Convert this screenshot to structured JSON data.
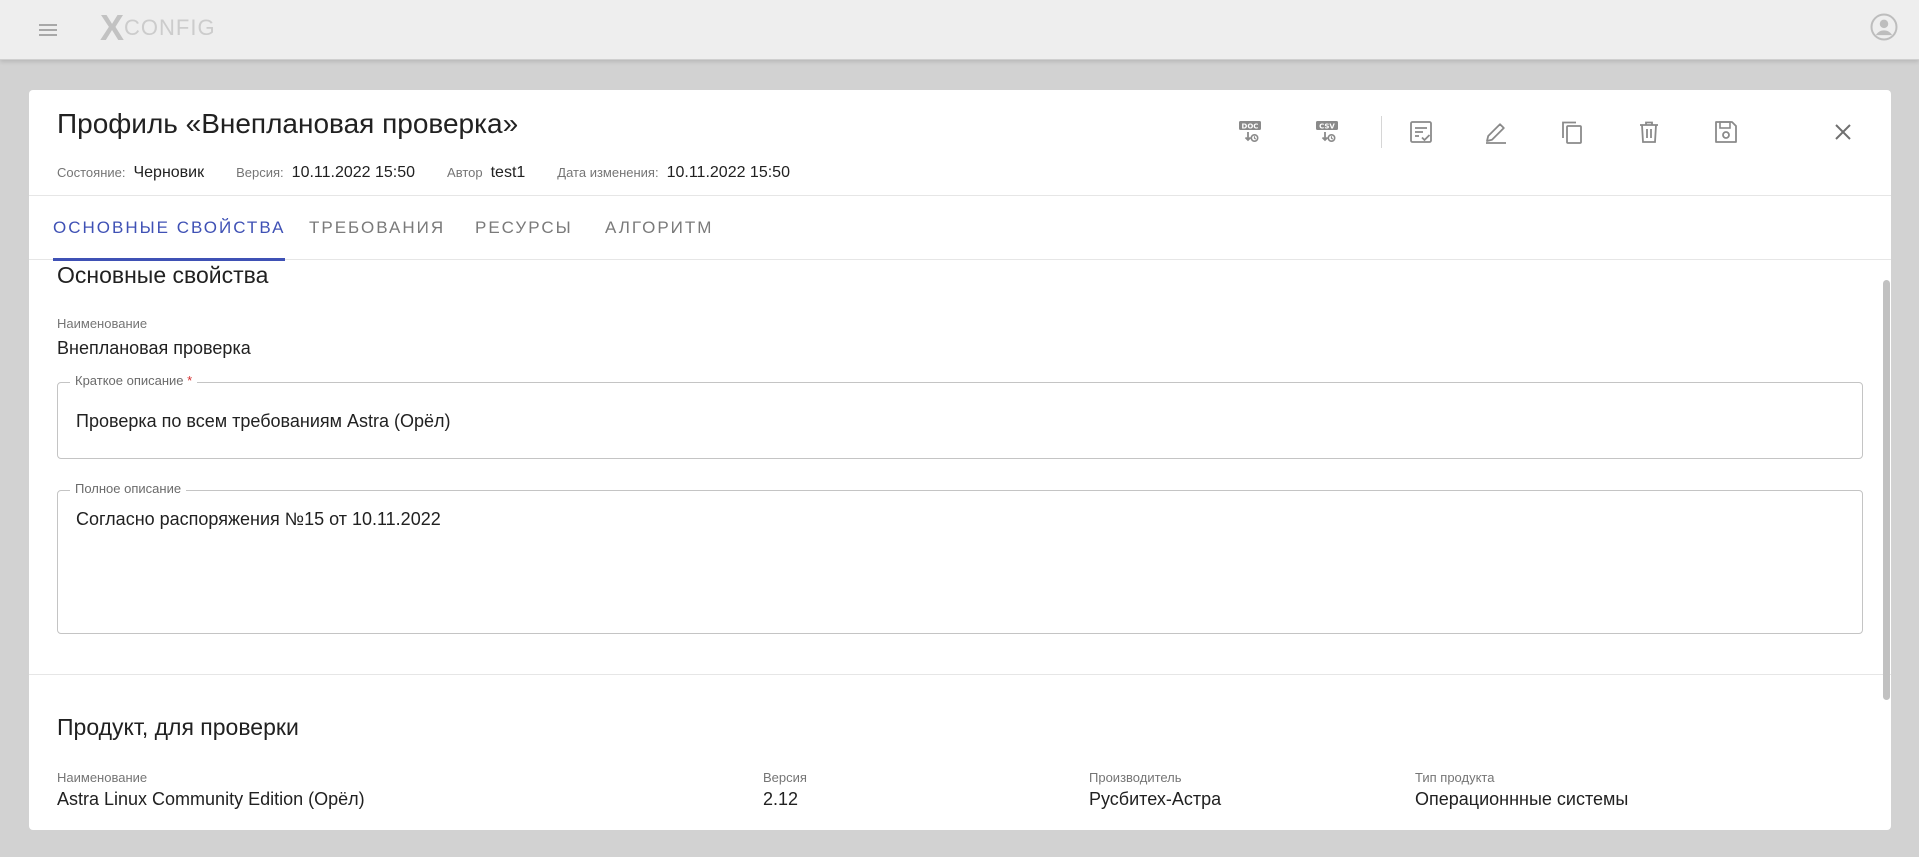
{
  "appbar": {
    "logo_mark": "X",
    "logo_text": "CONFIG"
  },
  "header": {
    "title": "Профиль «Внеплановая проверка»",
    "meta": [
      {
        "label": "Состояние:",
        "value": "Черновик"
      },
      {
        "label": "Версия:",
        "value": "10.11.2022 15:50"
      },
      {
        "label": "Автор",
        "value": "test1"
      },
      {
        "label": "Дата изменения:",
        "value": "10.11.2022 15:50"
      }
    ],
    "toolbar": {
      "doc_badge": "DOC",
      "csv_badge": "CSV"
    }
  },
  "tabs": [
    {
      "label": "ОСНОВНЫЕ СВОЙСТВА",
      "active": true
    },
    {
      "label": "ТРЕБОВАНИЯ",
      "active": false
    },
    {
      "label": "РЕСУРСЫ",
      "active": false
    },
    {
      "label": "АЛГОРИТМ",
      "active": false
    }
  ],
  "main": {
    "section_title": "Основные свойства",
    "name_label": "Наименование",
    "name_value": "Внеплановая проверка",
    "short_desc": {
      "label": "Краткое описание",
      "required_mark": "*",
      "value": "Проверка по всем требованиям Astra (Орёл)"
    },
    "full_desc": {
      "label": "Полное описание",
      "value": "Согласно распоряжения №15 от 10.11.2022"
    }
  },
  "product": {
    "section_title": "Продукт, для проверки",
    "fields": [
      {
        "label": "Наименование",
        "value": "Astra Linux Community Edition (Орёл)"
      },
      {
        "label": "Версия",
        "value": "2.12"
      },
      {
        "label": "Производитель",
        "value": "Русбитех-Астра"
      },
      {
        "label": "Тип продукта",
        "value": "Операционнные системы"
      }
    ]
  },
  "colors": {
    "accent": "#3f51b5",
    "icon": "#8a8a8a",
    "required": "#d32f2f"
  }
}
